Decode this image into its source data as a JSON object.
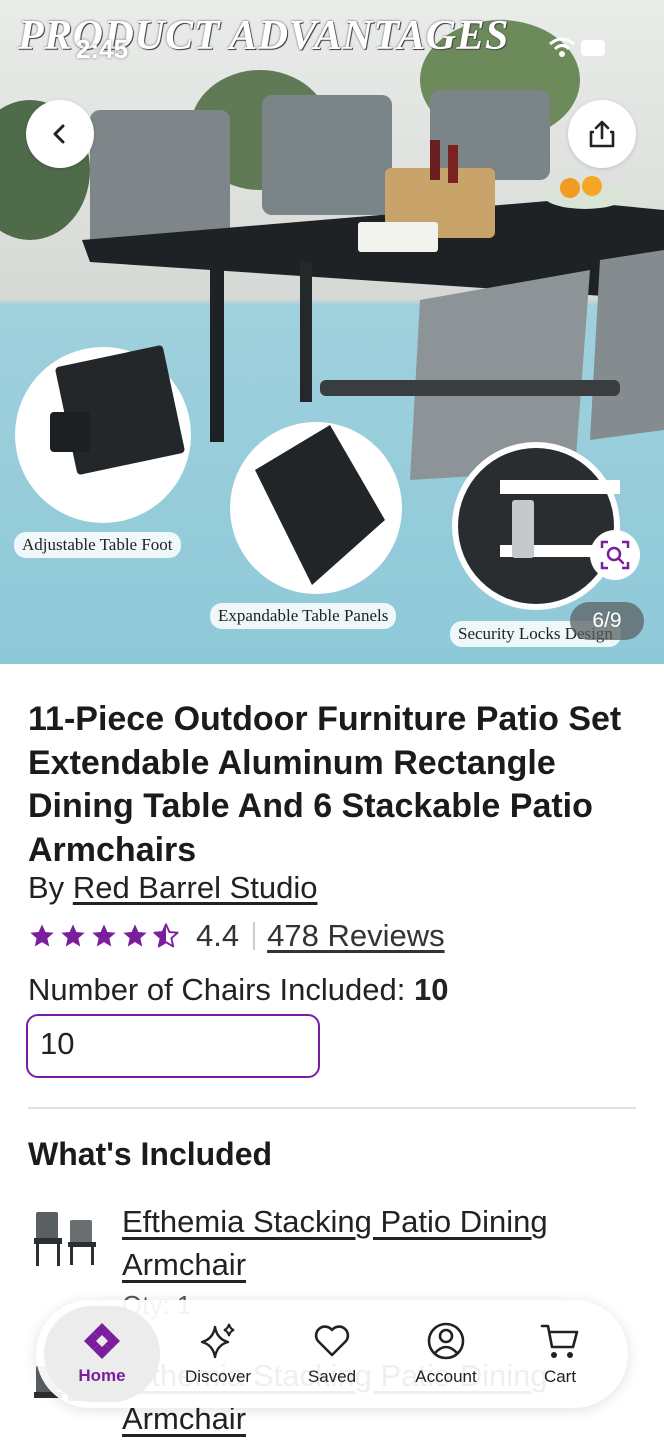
{
  "status_bar": {
    "time": "2:45"
  },
  "hero": {
    "banner_text": "PRODUCT ADVANTAGES",
    "features": [
      "Adjustable Table Foot",
      "Expandable Table Panels",
      "Security Locks Design"
    ],
    "image_counter": "6/9"
  },
  "product": {
    "title": "11-Piece Outdoor Furniture Patio Set Extendable Aluminum Rectangle Dining Table And 6 Stackable Patio Armchairs",
    "brand_prefix": "By",
    "brand": "Red Barrel Studio",
    "rating": 4.4,
    "rating_text": "4.4",
    "reviews_text": "478 Reviews",
    "option_label": "Number of Chairs Included:",
    "option_value": "10",
    "option_selected": "10"
  },
  "whats_included": {
    "title": "What's Included",
    "items": [
      {
        "name": "Efthemia Stacking Patio Dining Armchair",
        "sub": "Qty: 1"
      },
      {
        "name": "Efthemia Stacking Patio Dining Armchair"
      }
    ]
  },
  "nav": {
    "items": [
      {
        "label": "Home",
        "icon": "home-icon",
        "active": true
      },
      {
        "label": "Discover",
        "icon": "sparkle-icon"
      },
      {
        "label": "Saved",
        "icon": "heart-icon"
      },
      {
        "label": "Account",
        "icon": "account-icon"
      },
      {
        "label": "Cart",
        "icon": "cart-icon"
      }
    ]
  },
  "colors": {
    "accent": "#7B1E9E",
    "star": "#7B1E9E",
    "hero_backdrop": "#8EC9D8"
  }
}
